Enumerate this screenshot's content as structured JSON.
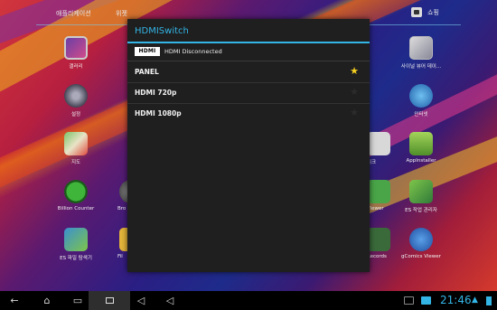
{
  "launcher": {
    "tabs": {
      "apps": "애플리케이션",
      "widgets": "위젯"
    },
    "shop_label": "쇼핑",
    "apps": [
      {
        "label": "갤러리",
        "icon": "gallery-icon"
      },
      {
        "label": "설정",
        "icon": "settings-icon"
      },
      {
        "label": "지도",
        "icon": "maps-icon"
      },
      {
        "label": "Billion Counter",
        "icon": "billion-counter-icon"
      },
      {
        "label": "ES 파일 탐색기",
        "icon": "es-file-explorer-icon"
      },
      {
        "label": "Bro",
        "icon": "browser-icon"
      },
      {
        "label": "Fil",
        "icon": "files-icon"
      },
      {
        "label": "리크",
        "icon": "app-icon"
      },
      {
        "label": "Viewer",
        "icon": "viewer-icon"
      },
      {
        "label": "Records",
        "icon": "records-icon"
      },
      {
        "label": "사이널 뷰어 데이...",
        "icon": "signal-viewer-icon"
      },
      {
        "label": "인터넷",
        "icon": "internet-icon"
      },
      {
        "label": "AppInstaller",
        "icon": "app-installer-icon"
      },
      {
        "label": "ES 작업 관리자",
        "icon": "es-task-manager-icon"
      },
      {
        "label": "gComics Viewer",
        "icon": "gcomics-viewer-icon"
      }
    ]
  },
  "dialog": {
    "title": "HDMISwitch",
    "hdmi_logo": "HDMI",
    "status": "HDMI Disconnected",
    "options": [
      {
        "label": "PANEL",
        "selected": true
      },
      {
        "label": "HDMI 720p",
        "selected": false
      },
      {
        "label": "HDMI 1080p",
        "selected": false
      }
    ]
  },
  "system_bar": {
    "clock": "21:46",
    "icons": [
      "back-icon",
      "home-icon",
      "recent-apps-icon",
      "screenshot-icon",
      "volume-down-icon",
      "volume-up-icon",
      "wifi-icon",
      "battery-icon"
    ]
  },
  "colors": {
    "accent": "#33b5e5",
    "star": "#f5d020",
    "dialog_bg": "#1f1f1f"
  }
}
